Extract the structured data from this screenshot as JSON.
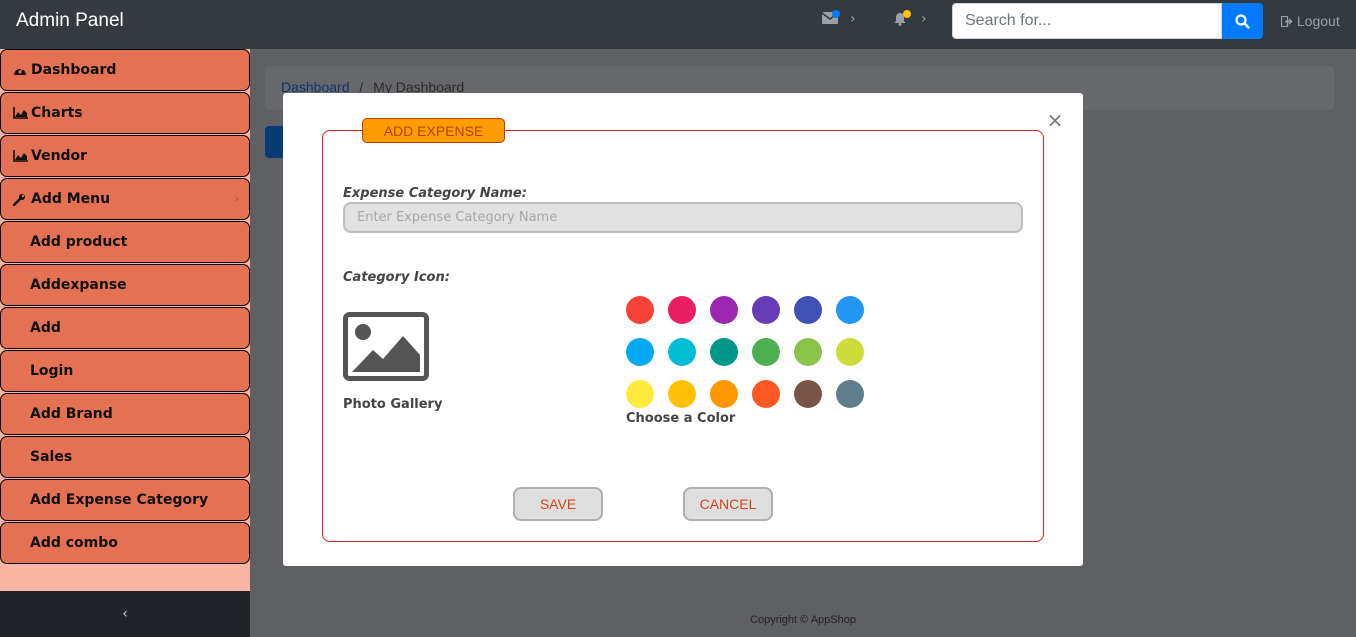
{
  "header": {
    "brand": "Admin Panel",
    "search_placeholder": "Search for...",
    "logout_label": "Logout",
    "mail_badge_color": "#007bff",
    "bell_badge_color": "#ffc107"
  },
  "sidebar": {
    "items": [
      {
        "label": "Dashboard",
        "icon": "dashboard-icon"
      },
      {
        "label": "Charts",
        "icon": "area-chart-icon"
      },
      {
        "label": "Vendor",
        "icon": "area-chart-icon"
      },
      {
        "label": "Add Menu",
        "icon": "wrench-icon"
      },
      {
        "label": "Add product"
      },
      {
        "label": "Addexpanse"
      },
      {
        "label": "Add"
      },
      {
        "label": "Login"
      },
      {
        "label": "Add Brand"
      },
      {
        "label": "Sales"
      },
      {
        "label": "Add Expense Category"
      },
      {
        "label": "Add combo"
      }
    ],
    "toggle_label": "‹"
  },
  "breadcrumb": {
    "link": "Dashboard",
    "separator": "/",
    "current": "My Dashboard"
  },
  "footer": {
    "copyright": "Copyright © AppShop"
  },
  "modal": {
    "legend": "ADD EXPENSE",
    "name_label": "Expense Category Name:",
    "name_placeholder": "Enter Expense Category Name",
    "icon_label": "Category Icon:",
    "gallery_label": "Photo Gallery",
    "color_label": "Choose a Color",
    "colors": [
      "#f44336",
      "#e91e63",
      "#9c27b0",
      "#673ab7",
      "#3f51b5",
      "#2196f3",
      "#03a9f4",
      "#00bcd4",
      "#009688",
      "#4caf50",
      "#8bc34a",
      "#cddc39",
      "#ffeb3b",
      "#ffc107",
      "#ff9800",
      "#ff5722",
      "#795548",
      "#607d8b"
    ],
    "save_label": "SAVE",
    "cancel_label": "CANCEL",
    "close_label": "×"
  }
}
